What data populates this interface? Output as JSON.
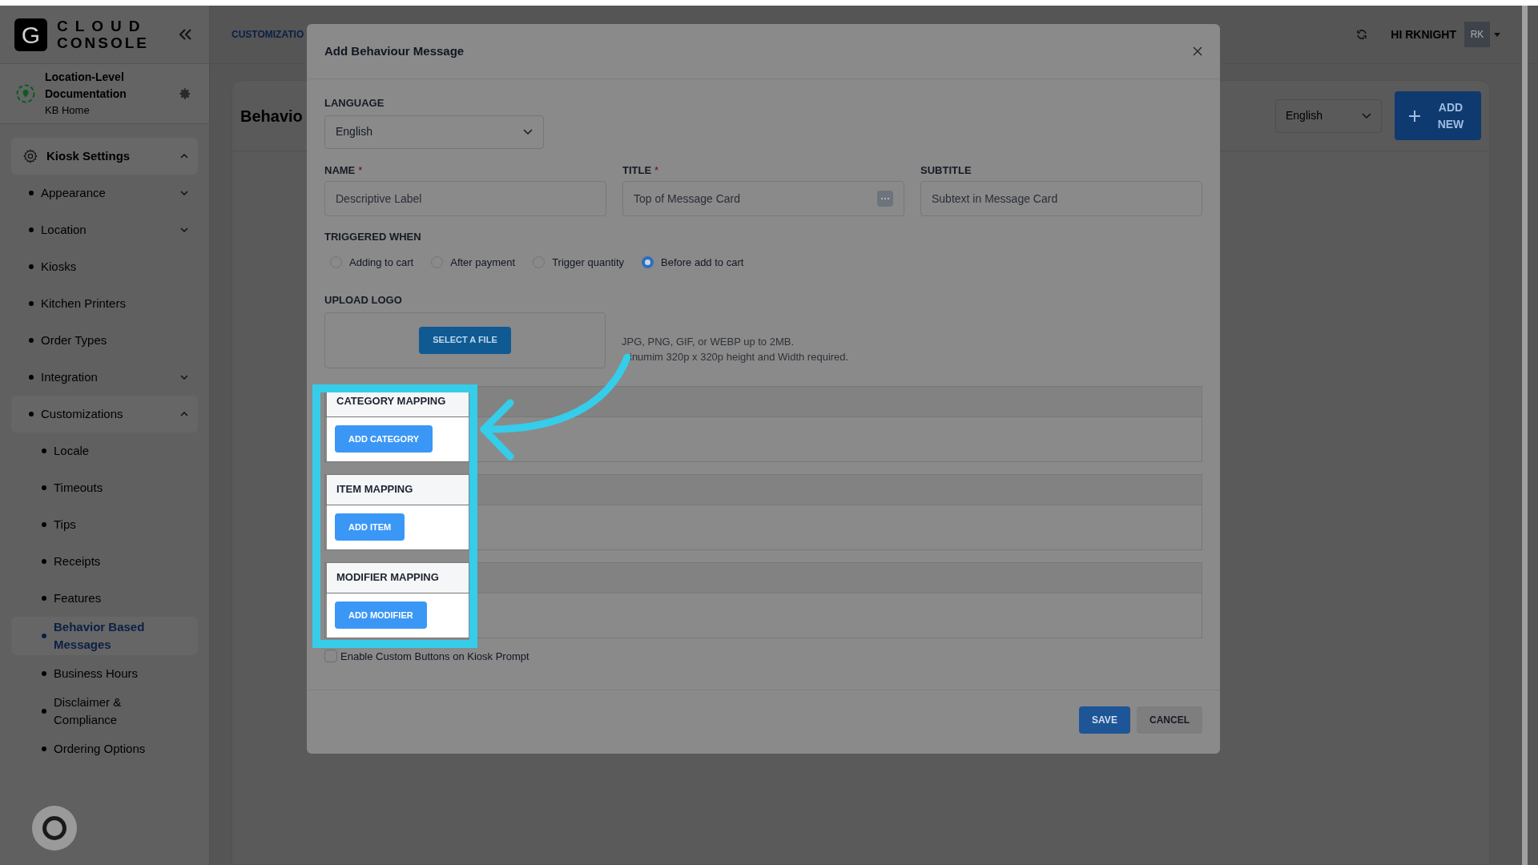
{
  "brand": {
    "logo_letter": "G",
    "name_top": "CLOUD",
    "name_bottom": "CONSOLE"
  },
  "header": {
    "breadcrumb": "CUSTOMIZATIO",
    "greeting": "HI RKNIGHT",
    "avatar": "RK"
  },
  "location": {
    "name": "Location-Level Documentation",
    "subtitle": "KB Home"
  },
  "sidebar": {
    "section": {
      "label": "Kiosk Settings",
      "expanded": true,
      "items": [
        {
          "label": "Appearance",
          "kind": "group",
          "expanded": false,
          "selected": false
        },
        {
          "label": "Location",
          "kind": "group",
          "expanded": false,
          "selected": false
        },
        {
          "label": "Kiosks",
          "kind": "link",
          "selected": false
        },
        {
          "label": "Kitchen Printers",
          "kind": "link",
          "selected": false
        },
        {
          "label": "Order Types",
          "kind": "link",
          "selected": false
        },
        {
          "label": "Integration",
          "kind": "group",
          "expanded": false,
          "selected": false
        },
        {
          "label": "Customizations",
          "kind": "group",
          "expanded": true,
          "selected": false,
          "children": [
            {
              "label": "Locale",
              "kind": "link",
              "selected": false
            },
            {
              "label": "Timeouts",
              "kind": "link",
              "selected": false
            },
            {
              "label": "Tips",
              "kind": "link",
              "selected": false
            },
            {
              "label": "Receipts",
              "kind": "link",
              "selected": false
            },
            {
              "label": "Features",
              "kind": "link",
              "selected": false
            },
            {
              "label": "Behavior Based Messages",
              "kind": "link",
              "selected": true
            },
            {
              "label": "Business Hours",
              "kind": "link",
              "selected": false
            },
            {
              "label": "Disclaimer & Compliance",
              "kind": "link",
              "selected": false
            },
            {
              "label": "Ordering Options",
              "kind": "link",
              "selected": false
            }
          ]
        }
      ]
    }
  },
  "page": {
    "title": "Behavio",
    "language": "English",
    "add_button": "ADD NEW"
  },
  "modal": {
    "title": "Add Behaviour Message",
    "language": {
      "label": "LANGUAGE",
      "value": "English"
    },
    "fields": [
      {
        "label": "NAME",
        "required_mark": "*",
        "placeholder": "Descriptive Label"
      },
      {
        "label": "TITLE",
        "required_mark": "*",
        "placeholder": "Top of Message Card",
        "kind": "emoji"
      },
      {
        "label": "SUBTITLE",
        "placeholder": "Subtext in Message Card"
      }
    ],
    "trigger": {
      "label": "TRIGGERED WHEN",
      "options": [
        {
          "label": "Adding to cart",
          "selected": false
        },
        {
          "label": "After payment",
          "selected": false
        },
        {
          "label": "Trigger quantity",
          "selected": false
        },
        {
          "label": "Before add to cart",
          "selected": true
        }
      ]
    },
    "upload": {
      "label": "UPLOAD LOGO",
      "button": "SELECT A FILE",
      "hints": [
        "JPG, PNG, GIF, or WEBP up to 2MB.",
        "inumim 320p x 320p height and Width required."
      ]
    },
    "mappings": [
      {
        "title": "CATEGORY MAPPING",
        "button": "ADD CATEGORY"
      },
      {
        "title": "ITEM MAPPING",
        "button": "ADD ITEM"
      },
      {
        "title": "MODIFIER MAPPING",
        "button": "ADD MODIFIER"
      }
    ],
    "custom_buttons": {
      "label": "Enable Custom Buttons on Kiosk Prompt",
      "checked": false
    },
    "save": "SAVE",
    "cancel": "CANCEL"
  }
}
